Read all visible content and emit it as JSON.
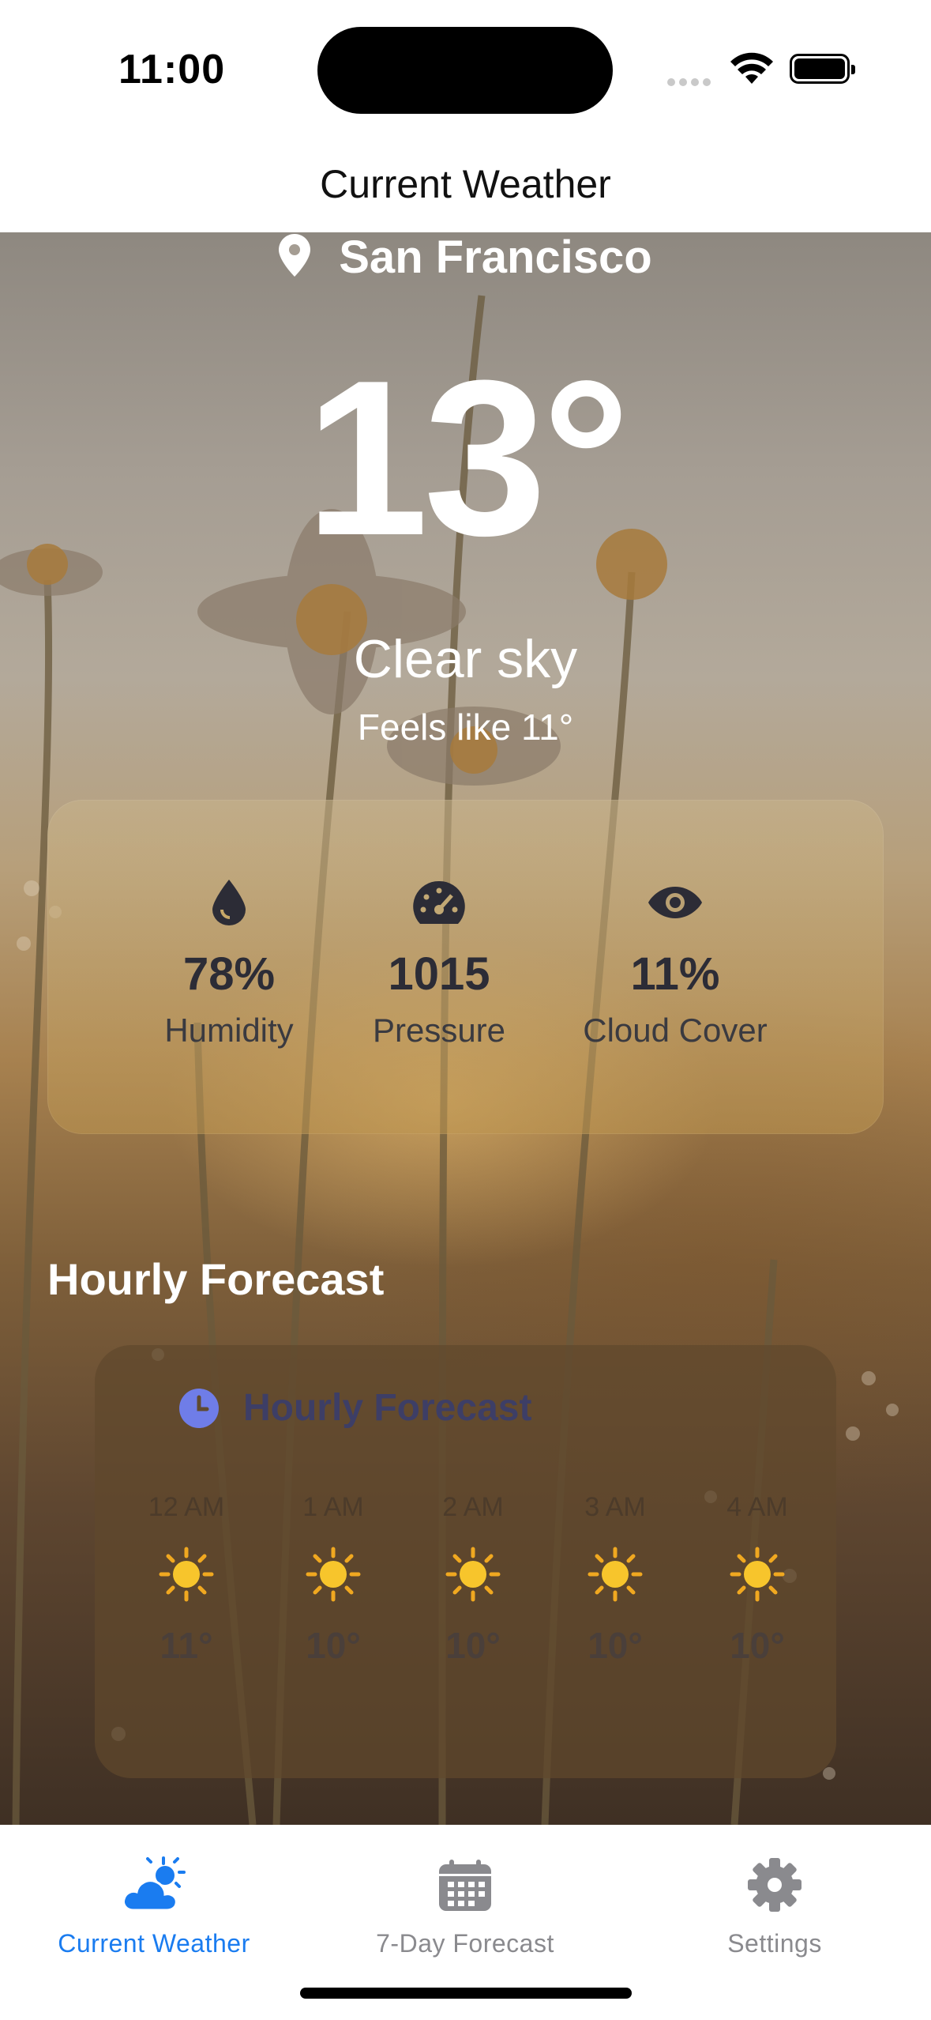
{
  "status": {
    "time": "11:00"
  },
  "nav": {
    "title": "Current Weather"
  },
  "weather": {
    "location": "San Francisco",
    "temperature": "13°",
    "condition": "Clear sky",
    "feels_like": "Feels like 11°"
  },
  "stats": [
    {
      "icon": "droplet-icon",
      "value": "78%",
      "label": "Humidity"
    },
    {
      "icon": "gauge-icon",
      "value": "1015",
      "label": "Pressure"
    },
    {
      "icon": "eye-icon",
      "value": "11%",
      "label": "Cloud Cover"
    }
  ],
  "hourly": {
    "section_title": "Hourly Forecast",
    "card_title": "Hourly Forecast",
    "items": [
      {
        "time": "12 AM",
        "icon": "sun-icon",
        "temp": "11°"
      },
      {
        "time": "1 AM",
        "icon": "sun-icon",
        "temp": "10°"
      },
      {
        "time": "2 AM",
        "icon": "sun-icon",
        "temp": "10°"
      },
      {
        "time": "3 AM",
        "icon": "sun-icon",
        "temp": "10°"
      },
      {
        "time": "4 AM",
        "icon": "sun-icon",
        "temp": "10°"
      }
    ]
  },
  "tabs": [
    {
      "label": "Current Weather",
      "icon": "cloud-sun-icon",
      "active": true
    },
    {
      "label": "7-Day Forecast",
      "icon": "calendar-icon",
      "active": false
    },
    {
      "label": "Settings",
      "icon": "gear-icon",
      "active": false
    }
  ],
  "colors": {
    "accent": "#1a7cf0",
    "inactive": "#8a8a8e",
    "clock_icon": "#6f7de8"
  }
}
